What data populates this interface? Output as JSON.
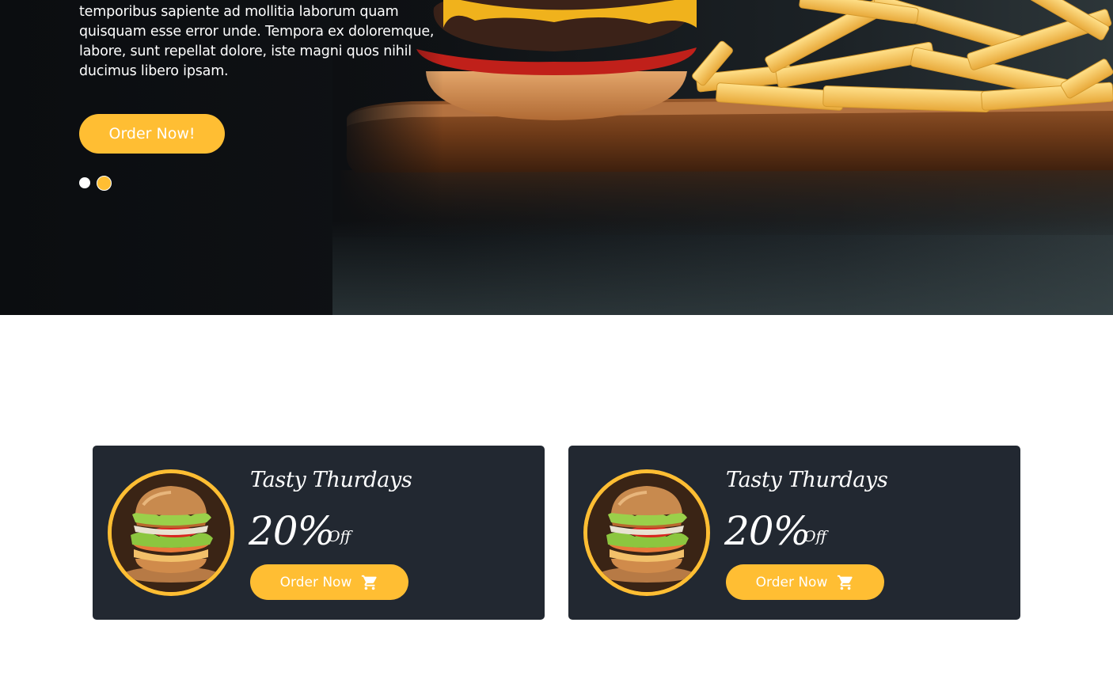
{
  "hero": {
    "text": "Doloremque, itaque aperiam facilis rerum, commodi, temporibus sapiente ad mollitia laborum quam quisquam esse error unde. Tempora ex doloremque, labore, sunt repellat dolore, iste magni quos nihil ducimus libero ipsam.",
    "button_label": "Order Now!",
    "slides": [
      "slide-1",
      "slide-2"
    ],
    "active_slide": 2
  },
  "offers": [
    {
      "title": "Tasty Thurdays",
      "percent": "20%",
      "off_label": "Off",
      "button_label": "Order Now",
      "icon": "cart-icon"
    },
    {
      "title": "Tasty Thurdays",
      "percent": "20%",
      "off_label": "Off",
      "button_label": "Order Now",
      "icon": "cart-icon"
    }
  ],
  "colors": {
    "accent": "#ffbe33",
    "card_bg": "#222831",
    "hero_bg": "#0f1215",
    "white": "#ffffff"
  }
}
